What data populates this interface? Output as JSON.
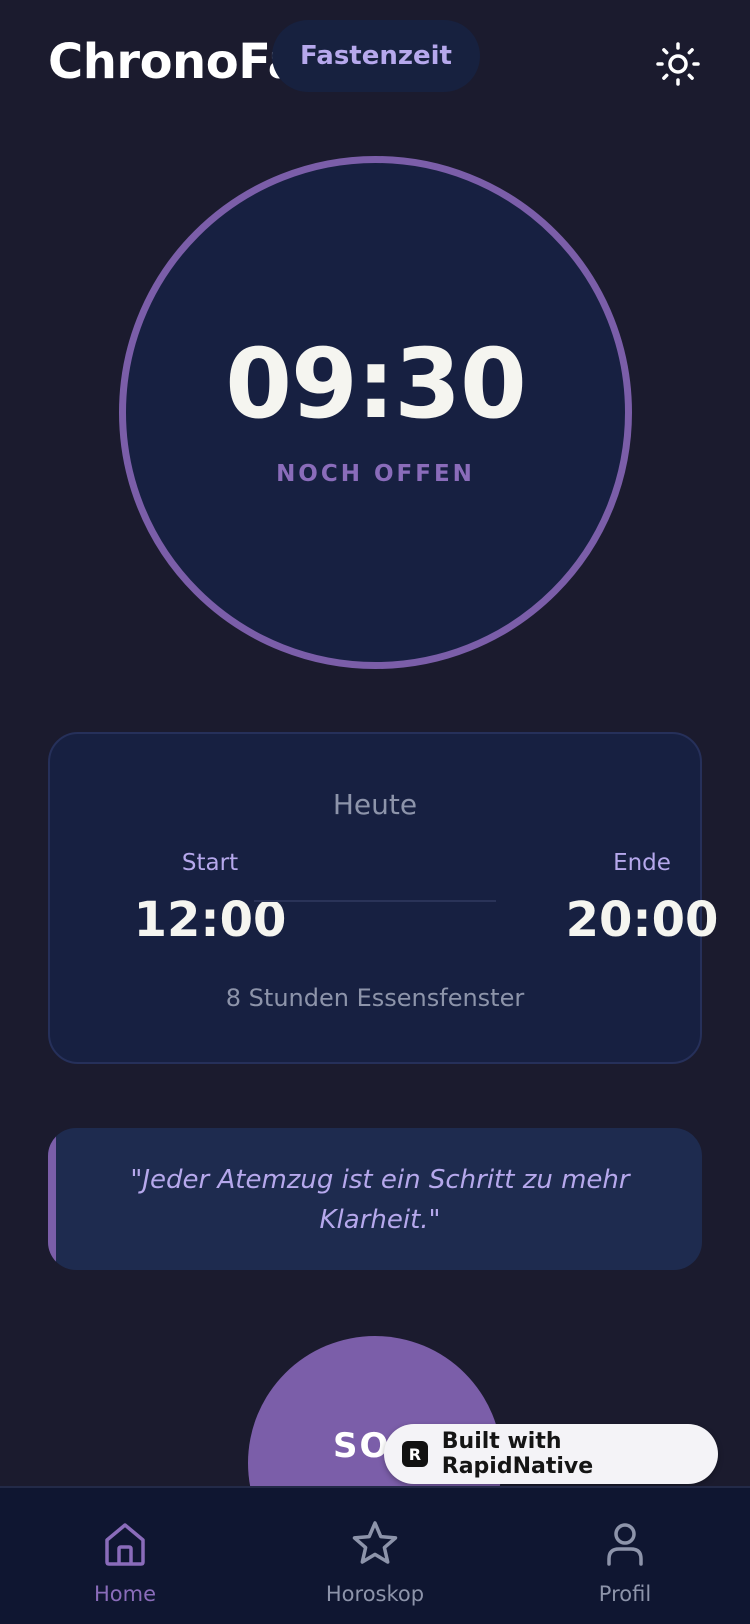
{
  "header": {
    "app_title": "ChronoFast",
    "mode_label": "Fastenzeit",
    "theme_icon": "sun-icon"
  },
  "timer": {
    "value": "09:30",
    "status": "NOCH OFFEN"
  },
  "today": {
    "title": "Heute",
    "start_label": "Start",
    "start_time": "12:00",
    "end_label": "Ende",
    "end_time": "20:00",
    "window_info": "8 Stunden Essensfenster"
  },
  "quote": {
    "text": "\"Jeder Atemzug ist ein Schritt zu mehr Klarheit.\""
  },
  "sos": {
    "label": "SOS"
  },
  "badge": {
    "logo_letter": "R",
    "text": "Built with RapidNative"
  },
  "nav": {
    "items": [
      {
        "label": "Home",
        "icon": "home-icon",
        "active": true
      },
      {
        "label": "Horoskop",
        "icon": "star-icon",
        "active": false
      },
      {
        "label": "Profil",
        "icon": "profile-icon",
        "active": false
      }
    ]
  },
  "colors": {
    "background": "#1b1b2e",
    "card": "#172041",
    "accent": "#7b5ea9",
    "accent_text": "#b6a8ec",
    "muted_text": "#8d94aa"
  }
}
